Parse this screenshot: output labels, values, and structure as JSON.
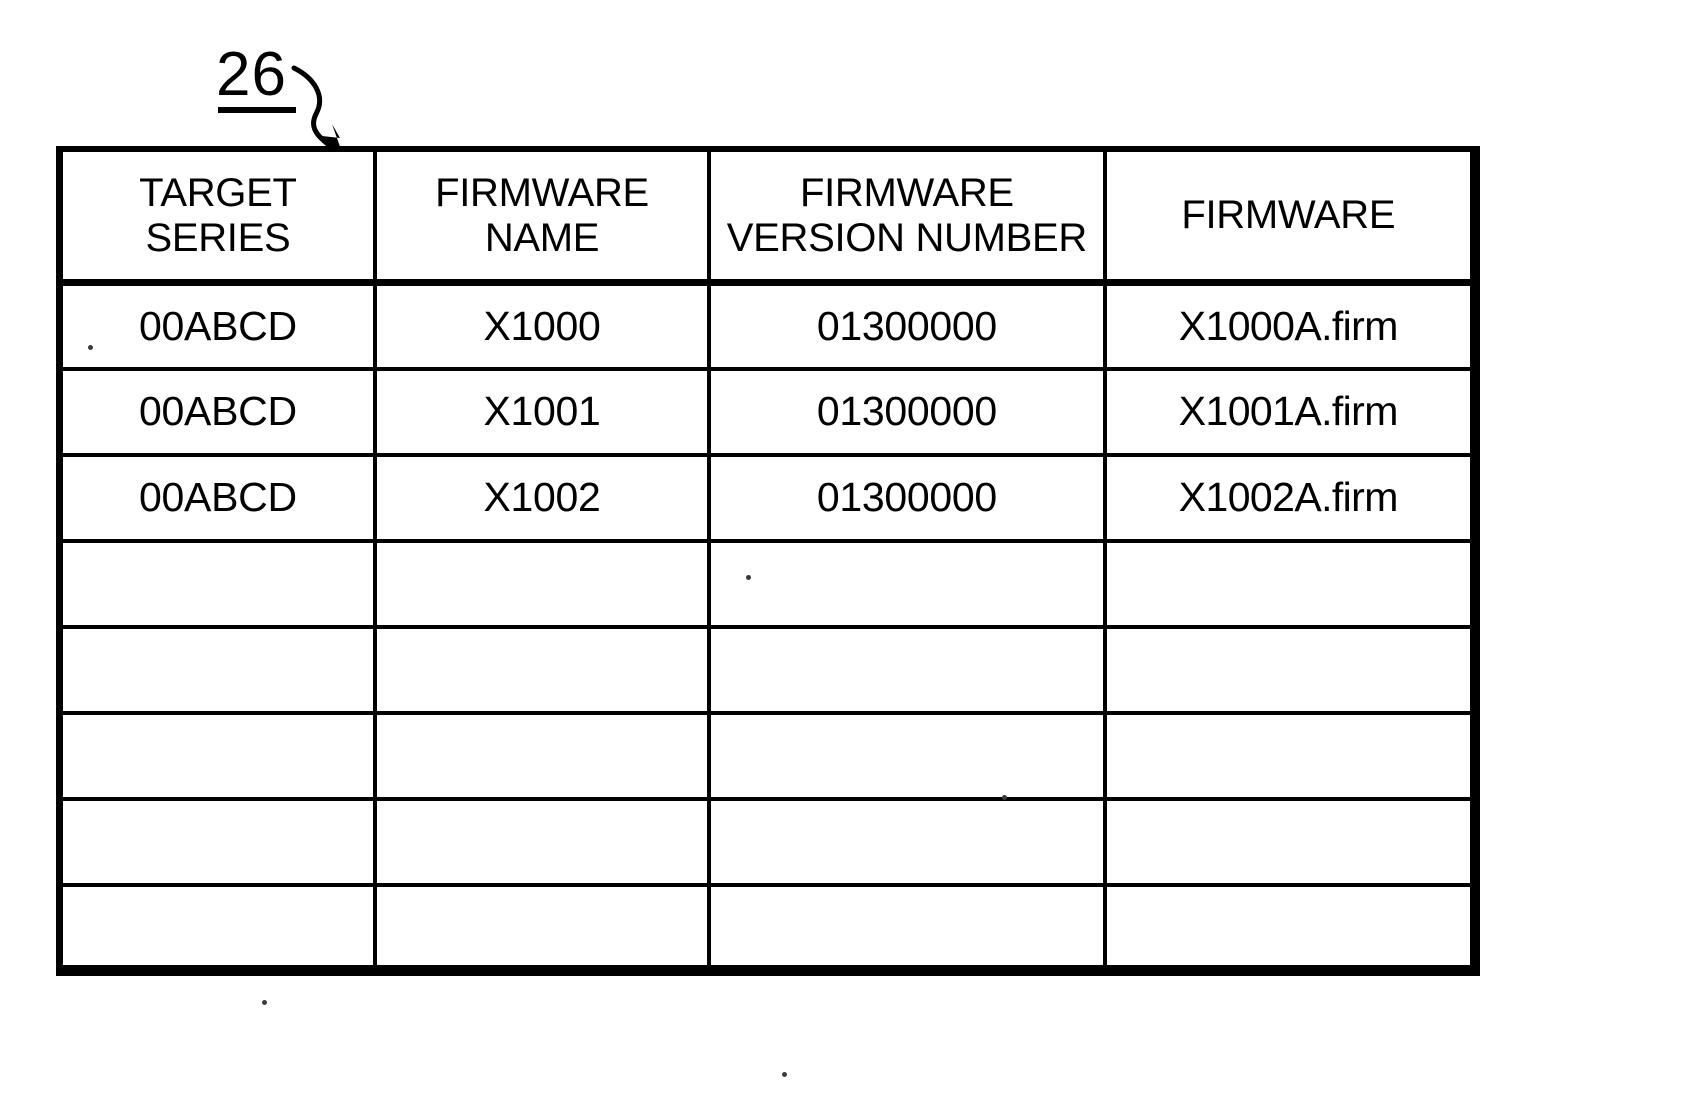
{
  "figure": {
    "reference_numeral": "26",
    "arrow_icon": "curved-leader-arrow-icon"
  },
  "table": {
    "columns": [
      {
        "id": "target-series",
        "line1": "TARGET",
        "line2": "SERIES"
      },
      {
        "id": "firmware-name",
        "line1": "FIRMWARE",
        "line2": "NAME"
      },
      {
        "id": "firmware-version-number",
        "line1": "FIRMWARE",
        "line2": "VERSION NUMBER"
      },
      {
        "id": "firmware",
        "line1": "FIRMWARE",
        "line2": ""
      }
    ],
    "rows": [
      {
        "target_series": "00ABCD",
        "firmware_name": "X1000",
        "firmware_version_number": "01300000",
        "firmware": "X1000A.firm"
      },
      {
        "target_series": "00ABCD",
        "firmware_name": "X1001",
        "firmware_version_number": "01300000",
        "firmware": "X1001A.firm"
      },
      {
        "target_series": "00ABCD",
        "firmware_name": "X1002",
        "firmware_version_number": "01300000",
        "firmware": "X1002A.firm"
      },
      {
        "target_series": "",
        "firmware_name": "",
        "firmware_version_number": "",
        "firmware": ""
      },
      {
        "target_series": "",
        "firmware_name": "",
        "firmware_version_number": "",
        "firmware": ""
      },
      {
        "target_series": "",
        "firmware_name": "",
        "firmware_version_number": "",
        "firmware": ""
      },
      {
        "target_series": "",
        "firmware_name": "",
        "firmware_version_number": "",
        "firmware": ""
      },
      {
        "target_series": "",
        "firmware_name": "",
        "firmware_version_number": "",
        "firmware": ""
      }
    ]
  },
  "colors": {
    "ink": "#000000",
    "paper": "#ffffff"
  }
}
